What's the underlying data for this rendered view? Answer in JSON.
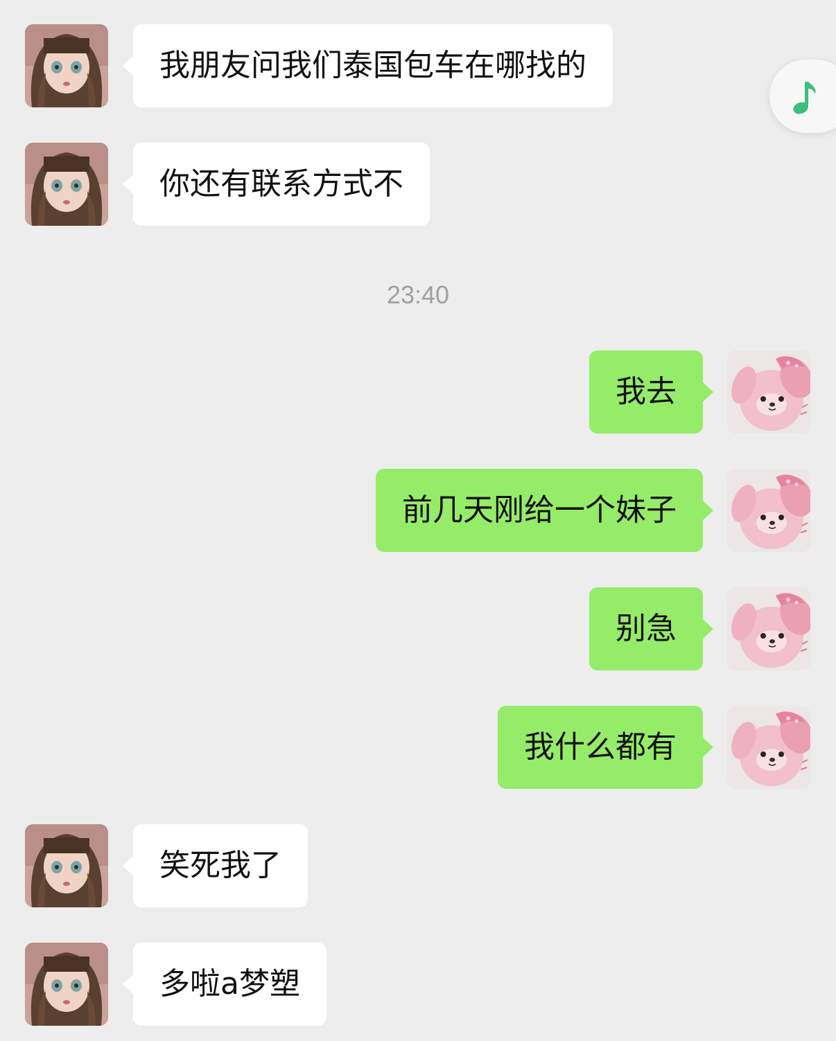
{
  "messages": [
    {
      "side": "left",
      "text": "我朋友问我们泰国包车在哪找的"
    },
    {
      "side": "left",
      "text": "你还有联系方式不"
    },
    {
      "side": "right",
      "text": "我去"
    },
    {
      "side": "right",
      "text": "前几天刚给一个妹子"
    },
    {
      "side": "right",
      "text": "别急"
    },
    {
      "side": "right",
      "text": "我什么都有"
    },
    {
      "side": "left",
      "text": "笑死我了"
    },
    {
      "side": "left",
      "text": "多啦a梦塑"
    }
  ],
  "timestamp": "23:40",
  "floating_widget": {
    "icon": "music-note-icon",
    "color": "#3cbf7a"
  },
  "colors": {
    "background": "#ededed",
    "incoming_bubble": "#ffffff",
    "outgoing_bubble": "#95ec69"
  },
  "avatars": {
    "incoming": "doll-girl-avatar",
    "outgoing": "pink-plush-bunny-avatar"
  }
}
